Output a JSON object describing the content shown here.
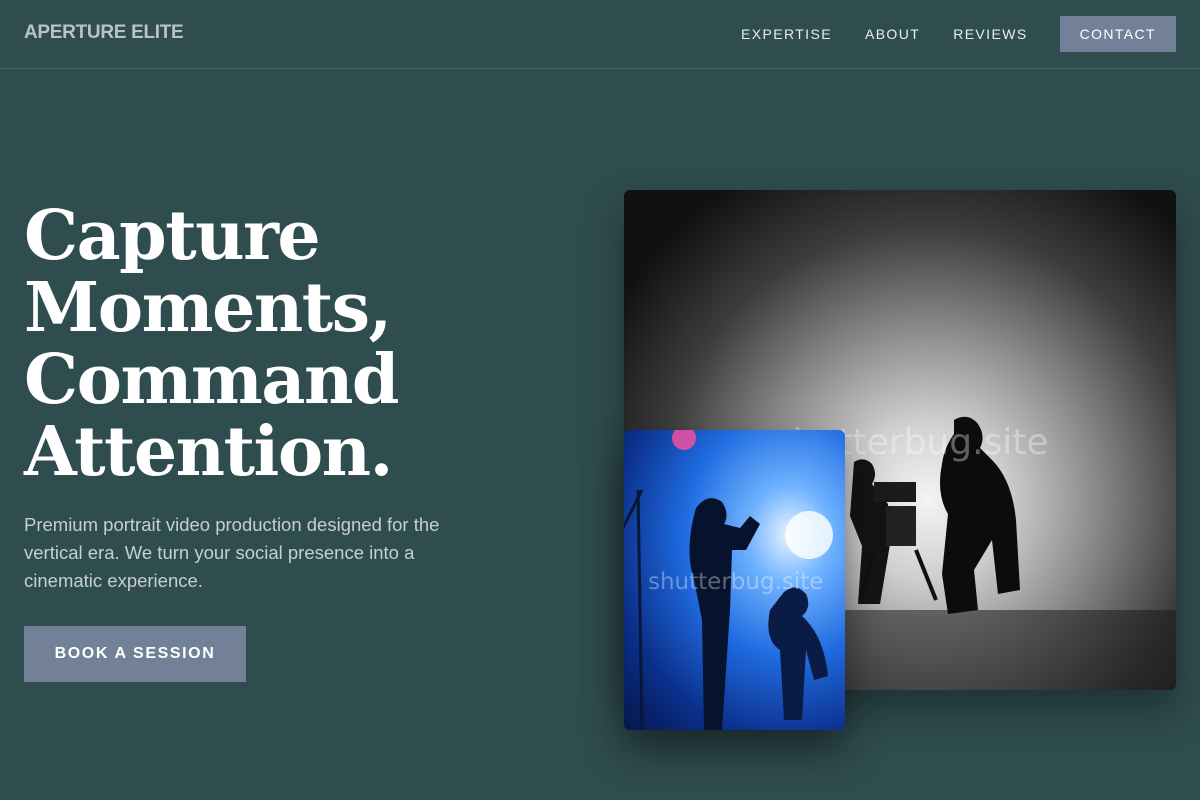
{
  "header": {
    "logo": "APERTURE ELITE",
    "nav": [
      {
        "label": "EXPERTISE"
      },
      {
        "label": "ABOUT"
      },
      {
        "label": "REVIEWS"
      }
    ],
    "contact_label": "CONTACT"
  },
  "hero": {
    "title_lines": [
      "Capture",
      "Moments,",
      "Command",
      "Attention."
    ],
    "subtitle": "Premium portrait video production designed for the vertical era. We turn your social presence into a cinematic experience.",
    "cta_label": "BOOK A SESSION"
  },
  "images": {
    "main_watermark": "shutterbug.site",
    "small_watermark": "shutterbug.site"
  },
  "colors": {
    "background": "#2f4c4f",
    "accent_button": "#728197"
  }
}
